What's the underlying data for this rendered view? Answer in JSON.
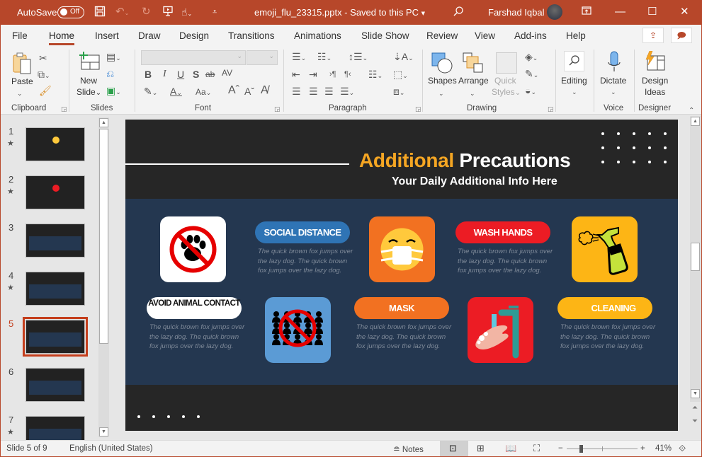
{
  "titlebar": {
    "autosave_label": "AutoSave",
    "autosave_state": "Off",
    "filename": "emoji_flu_23315.pptx",
    "save_status": "Saved to this PC",
    "user_name": "Farshad Iqbal",
    "icons": [
      "save-icon",
      "undo-icon",
      "redo-icon",
      "present-icon",
      "touch-mode-icon",
      "customize-qat-icon",
      "search-icon",
      "ribbon-display-icon",
      "minimize-icon",
      "maximize-icon",
      "close-icon"
    ]
  },
  "tabs": [
    "File",
    "Home",
    "Insert",
    "Draw",
    "Design",
    "Transitions",
    "Animations",
    "Slide Show",
    "Review",
    "View",
    "Add-ins",
    "Help"
  ],
  "active_tab": "Home",
  "ribbon": {
    "groups": {
      "clipboard": "Clipboard",
      "slides": "Slides",
      "font": "Font",
      "paragraph": "Paragraph",
      "drawing": "Drawing",
      "voice": "Voice",
      "designer": "Designer"
    },
    "buttons": {
      "paste": "Paste",
      "new_slide_1": "New",
      "new_slide_2": "Slide",
      "shapes": "Shapes",
      "arrange": "Arrange",
      "quick_styles_1": "Quick",
      "quick_styles_2": "Styles",
      "editing": "Editing",
      "dictate": "Dictate",
      "design_ideas_1": "Design",
      "design_ideas_2": "Ideas"
    },
    "font_buttons": [
      "B",
      "I",
      "U",
      "S",
      "ab",
      "AV"
    ],
    "font_name_value": "",
    "font_size_value": ""
  },
  "thumbnails": [
    {
      "num": "1",
      "star": true
    },
    {
      "num": "2",
      "star": true
    },
    {
      "num": "3",
      "star": false
    },
    {
      "num": "4",
      "star": true
    },
    {
      "num": "5",
      "star": false,
      "active": true
    },
    {
      "num": "6",
      "star": false
    },
    {
      "num": "7",
      "star": true
    }
  ],
  "slide": {
    "title_accent": "Additional",
    "title_rest": "Precautions",
    "subtitle": "Your Daily Additional Info Here",
    "items": [
      {
        "label": "SOCIAL DISTANCE",
        "color": "#2f74b5",
        "text": "The quick brown fox jumps over the lazy dog. The quick brown fox jumps over the lazy dog."
      },
      {
        "label": "WASH HANDS",
        "color": "#ec1c24",
        "text": "The quick brown fox jumps over the lazy dog. The quick brown fox jumps over the lazy dog."
      },
      {
        "label": "AVOID ANIMAL CONTACT",
        "color": "#ffffff",
        "text": "The quick brown fox jumps over the lazy dog. The quick brown fox jumps over the lazy dog."
      },
      {
        "label": "MASK",
        "color": "#f27121",
        "text": "The quick brown fox jumps over the lazy dog. The quick brown fox jumps over the lazy dog."
      },
      {
        "label": "CLEANING",
        "color": "#fdb515",
        "text": "The quick brown fox jumps over the lazy dog. The quick brown fox jumps over the lazy dog."
      }
    ],
    "tiles": [
      {
        "name": "no-animals-icon",
        "bg": "#ffffff"
      },
      {
        "name": "mask-emoji-icon",
        "bg": "#f27121"
      },
      {
        "name": "spray-bottle-icon",
        "bg": "#fdb515"
      },
      {
        "name": "no-crowds-icon",
        "bg": "#5b9bd5"
      },
      {
        "name": "hand-washing-icon",
        "bg": "#ec1c24"
      }
    ]
  },
  "statusbar": {
    "slide_info": "Slide 5 of 9",
    "language": "English (United States)",
    "notes_label": "Notes",
    "zoom_level": "41%",
    "zoom_fraction": 0.2
  }
}
